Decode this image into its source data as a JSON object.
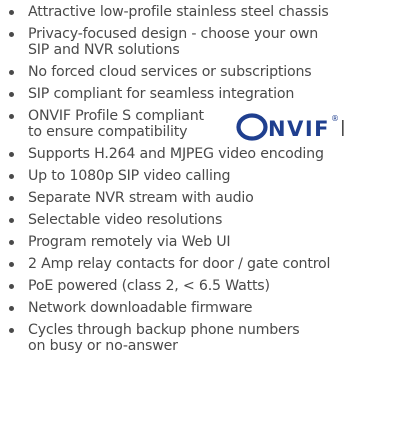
{
  "features": [
    {
      "lines": [
        "Attractive low-profile stainless steel chassis"
      ]
    },
    {
      "lines": [
        "Privacy-focused design - choose your own",
        "SIP and NVR solutions"
      ]
    },
    {
      "lines": [
        "No forced cloud services or subscriptions"
      ]
    },
    {
      "lines": [
        "SIP compliant for seamless integration"
      ]
    },
    {
      "lines": [
        "ONVIF Profile S compliant",
        "to ensure compatibility"
      ]
    },
    {
      "lines": [
        "Supports H.264 and MJPEG video encoding"
      ]
    },
    {
      "lines": [
        "Up to 1080p SIP video calling"
      ]
    },
    {
      "lines": [
        "Separate NVR stream with audio"
      ]
    },
    {
      "lines": [
        "Selectable video resolutions"
      ]
    },
    {
      "lines": [
        "Program remotely via Web UI"
      ]
    },
    {
      "lines": [
        "2 Amp relay contacts for door / gate control"
      ]
    },
    {
      "lines": [
        "PoE powered (class 2, < 6.5 Watts)"
      ]
    },
    {
      "lines": [
        "Network downloadable firmware"
      ]
    },
    {
      "lines": [
        "Cycles through backup phone numbers",
        "on busy or no-answer"
      ]
    }
  ],
  "onvif_logo": {
    "text": "ONVIF",
    "registered_mark": "®",
    "color": "#1f3f8f"
  },
  "colors": {
    "text": "#4a4a4a",
    "bullet": "#4a4a4a",
    "background": "#ffffff"
  }
}
